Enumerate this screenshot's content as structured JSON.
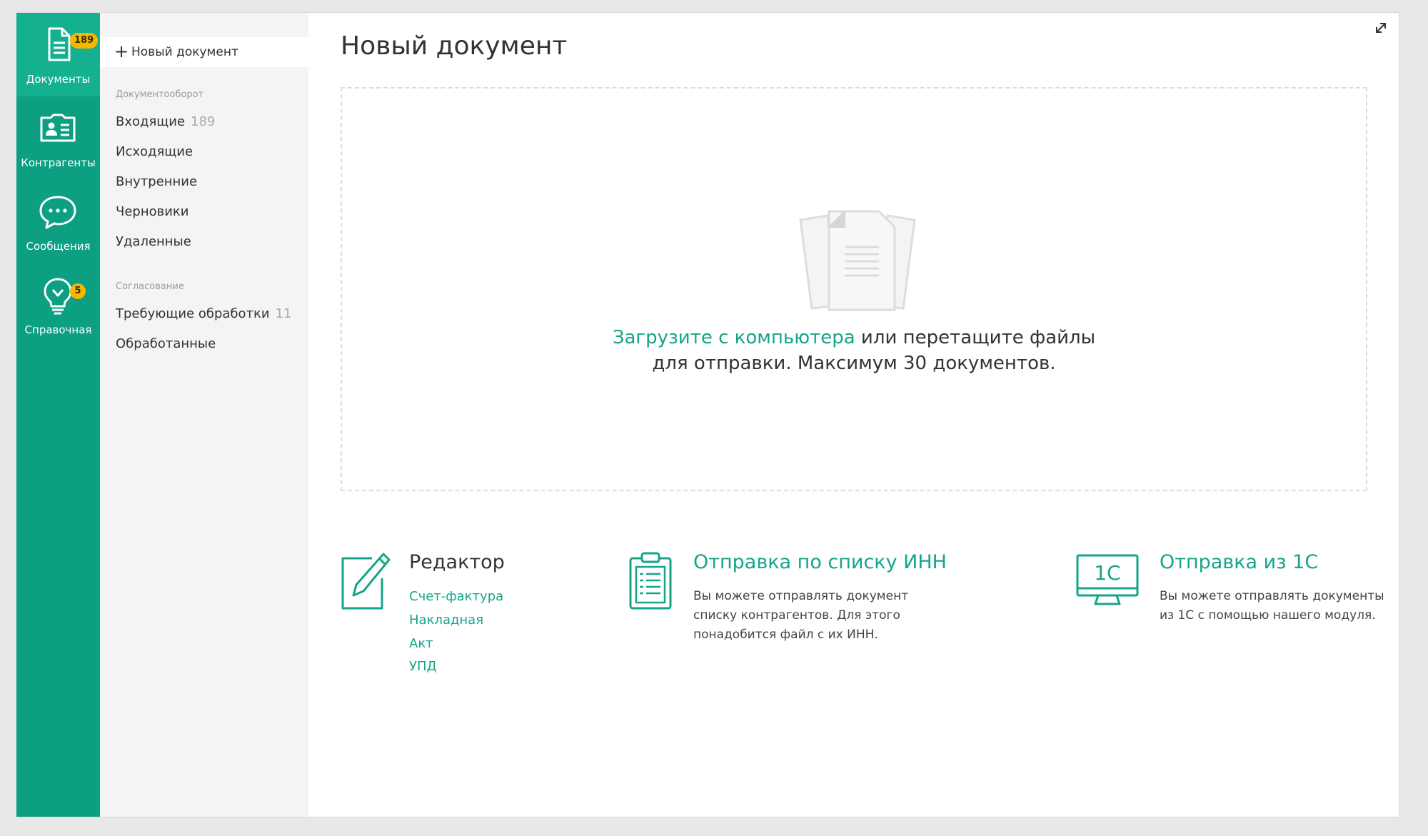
{
  "rail": {
    "items": [
      {
        "label": "Документы",
        "icon": "document-icon",
        "badge": "189",
        "active": true
      },
      {
        "label": "Контрагенты",
        "icon": "contact-card-icon"
      },
      {
        "label": "Сообщения",
        "icon": "chat-bubble-icon"
      },
      {
        "label": "Справочная",
        "icon": "lightbulb-icon",
        "badge": "5"
      }
    ]
  },
  "subnav": {
    "new_document": "Новый документ",
    "groups": [
      {
        "title": "Документооборот",
        "items": [
          {
            "label": "Входящие",
            "count": "189"
          },
          {
            "label": "Исходящие"
          },
          {
            "label": "Внутренние"
          },
          {
            "label": "Черновики"
          },
          {
            "label": "Удаленные"
          }
        ]
      },
      {
        "title": "Согласование",
        "items": [
          {
            "label": "Требующие обработки",
            "count": "11"
          },
          {
            "label": "Обработанные"
          }
        ]
      }
    ]
  },
  "main": {
    "title": "Новый документ",
    "dropzone": {
      "upload_link": "Загрузите с компьютера",
      "text_rest": " или перетащите файлы",
      "text_line2": "для отправки. Максимум 30 документов."
    },
    "features": {
      "editor": {
        "title": "Редактор",
        "links": [
          "Счет-фактура",
          "Накладная",
          "Акт",
          "УПД"
        ]
      },
      "inn": {
        "title": "Отправка по списку ИНН",
        "desc": "Вы можете отправлять документ списку контрагентов. Для этого понадобится файл с их ИНН."
      },
      "onec": {
        "title": "Отправка из 1С",
        "icon_text": "1С",
        "desc": "Вы можете отправлять документы из 1С с помощью нашего модуля."
      }
    }
  },
  "colors": {
    "rail": "#0c9f82",
    "rail_active": "#14b08f",
    "accent": "#14a589",
    "badge": "#f5b800"
  }
}
